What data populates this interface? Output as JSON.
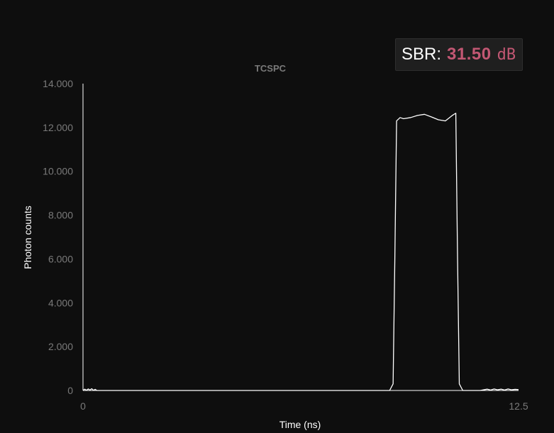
{
  "sbr": {
    "label": "SBR:",
    "value": "31.50",
    "unit": "dB"
  },
  "colors": {
    "background": "#0e0e0e",
    "line": "#ffffff",
    "axis": "#ffffff",
    "tick_text": "#7a7a7a",
    "accent": "#c25773"
  },
  "chart_data": {
    "type": "line",
    "title": "TCSPC",
    "xlabel": "Time (ns)",
    "ylabel": "Photon counts",
    "xlim": [
      0,
      12.5
    ],
    "ylim": [
      0,
      14000
    ],
    "x_ticks": [
      {
        "value": 0,
        "label": "0"
      },
      {
        "value": 12.5,
        "label": "12.5"
      }
    ],
    "y_ticks": [
      {
        "value": 0,
        "label": "0"
      },
      {
        "value": 2000,
        "label": "2.000"
      },
      {
        "value": 4000,
        "label": "4.000"
      },
      {
        "value": 6000,
        "label": "6.000"
      },
      {
        "value": 8000,
        "label": "8.000"
      },
      {
        "value": 10000,
        "label": "10.000"
      },
      {
        "value": 12000,
        "label": "12.000"
      },
      {
        "value": 14000,
        "label": "14.000"
      }
    ],
    "grid": false,
    "series": [
      {
        "color": "#ffffff",
        "x": [
          0,
          0.05,
          0.1,
          0.15,
          0.2,
          0.25,
          0.3,
          0.35,
          0.4,
          0.5,
          1.0,
          3.0,
          6.0,
          8.8,
          8.9,
          8.95,
          9.0,
          9.1,
          9.2,
          9.4,
          9.6,
          9.8,
          10.0,
          10.2,
          10.4,
          10.6,
          10.7,
          10.75,
          10.8,
          10.9,
          11.0,
          11.2,
          11.4,
          11.5,
          11.6,
          11.7,
          11.8,
          11.9,
          12.0,
          12.1,
          12.2,
          12.3,
          12.4,
          12.5
        ],
        "y": [
          0,
          60,
          10,
          70,
          20,
          80,
          10,
          50,
          0,
          0,
          0,
          0,
          0,
          0,
          300,
          6000,
          12300,
          12450,
          12400,
          12450,
          12550,
          12600,
          12480,
          12350,
          12300,
          12550,
          12650,
          6000,
          300,
          0,
          0,
          0,
          0,
          30,
          60,
          20,
          70,
          30,
          60,
          20,
          70,
          30,
          50,
          40
        ]
      }
    ]
  }
}
